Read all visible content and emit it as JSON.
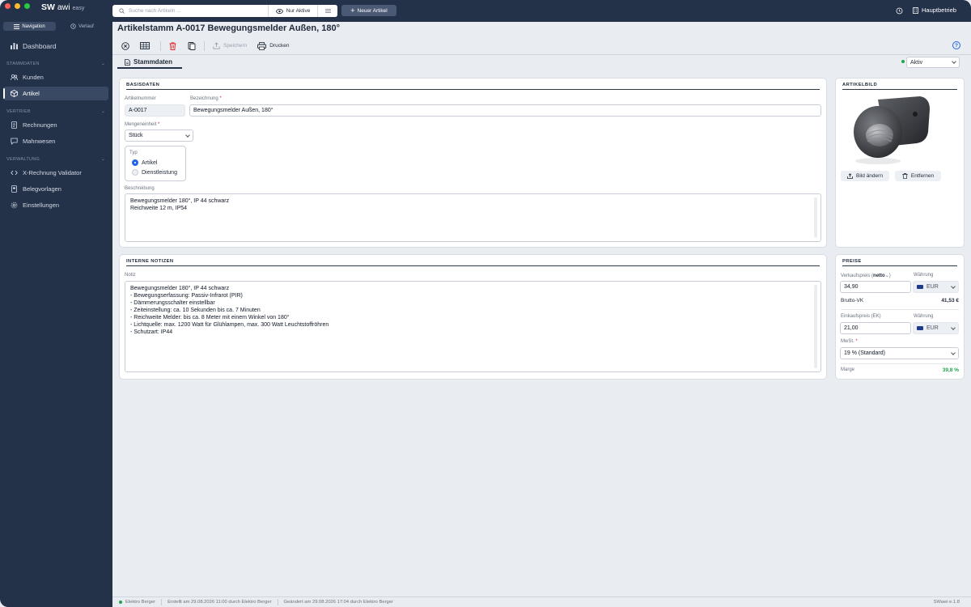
{
  "app": {
    "brand_sw": "SW",
    "brand_awi": "awi",
    "brand_edition": "easy"
  },
  "sidebar": {
    "tab_navigation": "Navigation",
    "tab_history": "Verlauf",
    "dashboard": "Dashboard",
    "sections": [
      {
        "title": "STAMMDATEN",
        "items": [
          {
            "label": "Kunden"
          },
          {
            "label": "Artikel"
          }
        ]
      },
      {
        "title": "VERTRIEB",
        "items": [
          {
            "label": "Rechnungen"
          },
          {
            "label": "Mahnwesen"
          }
        ]
      },
      {
        "title": "VERWALTUNG",
        "items": [
          {
            "label": "X-Rechnung Validator"
          },
          {
            "label": "Belegvorlagen"
          },
          {
            "label": "Einstellungen"
          }
        ]
      }
    ]
  },
  "topbar": {
    "search_placeholder": "Suche nach Artikeln ...",
    "filter_label": "Nur Aktive",
    "new_button": "Neuer Artikel",
    "company": "Hauptbetrieb"
  },
  "page": {
    "title": "Artikelstamm  A-0017  Bewegungsmelder Außen, 180°",
    "tab_label": "Stammdaten",
    "status_value": "Aktiv"
  },
  "toolbar": {
    "save": "Speichern",
    "print": "Drucken"
  },
  "basisdaten": {
    "title": "BASISDATEN",
    "article_number_label": "Artikelnummer",
    "article_number": "A-0017",
    "designation_label": "Bezeichnung",
    "designation": "Bewegungsmelder Außen, 180°",
    "unit_label": "Mengeneinheit",
    "unit_value": "Stück",
    "type_label": "Typ",
    "type_article": "Artikel",
    "type_service": "Dienstleistung",
    "description_label": "Beschreibung",
    "description": "Bewegungsmelder 180°, IP 44 schwarz\nReichweite 12 m, IP54"
  },
  "notes": {
    "title": "INTERNE NOTIZEN",
    "label": "Notiz",
    "text": "Bewegungsmelder 180°, IP 44 schwarz\n- Bewegungserfassung: Passiv-Infrarot (PIR)\n- Dämmerungsschalter einstellbar\n- Zeiteinstellung: ca. 10 Sekunden bis ca. 7 Minuten\n- Reichweite Melder: bis ca. 8 Meter mit einem Winkel von 180°\n- Lichtquelle: max. 1200 Watt für Glühlampen, max. 300 Watt Leuchtstoffröhren\n- Schutzart: IP44"
  },
  "image_card": {
    "title": "ARTIKELBILD",
    "change": "Bild ändern",
    "remove": "Entfernen"
  },
  "prices": {
    "title": "PREISE",
    "sale_label_pre": "Verkaufspreis (",
    "sale_label_bold": "netto",
    "sale_label_post": ")",
    "sale_value": "34,90",
    "currency_label": "Währung",
    "currency": "EUR",
    "gross_label": "Brutto-VK",
    "gross_value": "41,53 €",
    "purchase_label": "Einkaufspreis (EK)",
    "purchase_value": "21,00",
    "vat_label": "MwSt.",
    "vat_value": "19 % (Standard)",
    "margin_label": "Marge",
    "margin_value": "39,8 %"
  },
  "footer": {
    "company": "Elektro Berger",
    "created": "Erstellt am 29.08.2026 11:00 durch Elektro Berger",
    "changed": "Geändert am 29.08.2026 17:04 durch Elektro Berger",
    "version": "SWawi e.1.8"
  },
  "colors": {
    "sidebar": "#233149",
    "accent": "#2563eb",
    "danger": "#dc2626",
    "success": "#22a34a"
  }
}
